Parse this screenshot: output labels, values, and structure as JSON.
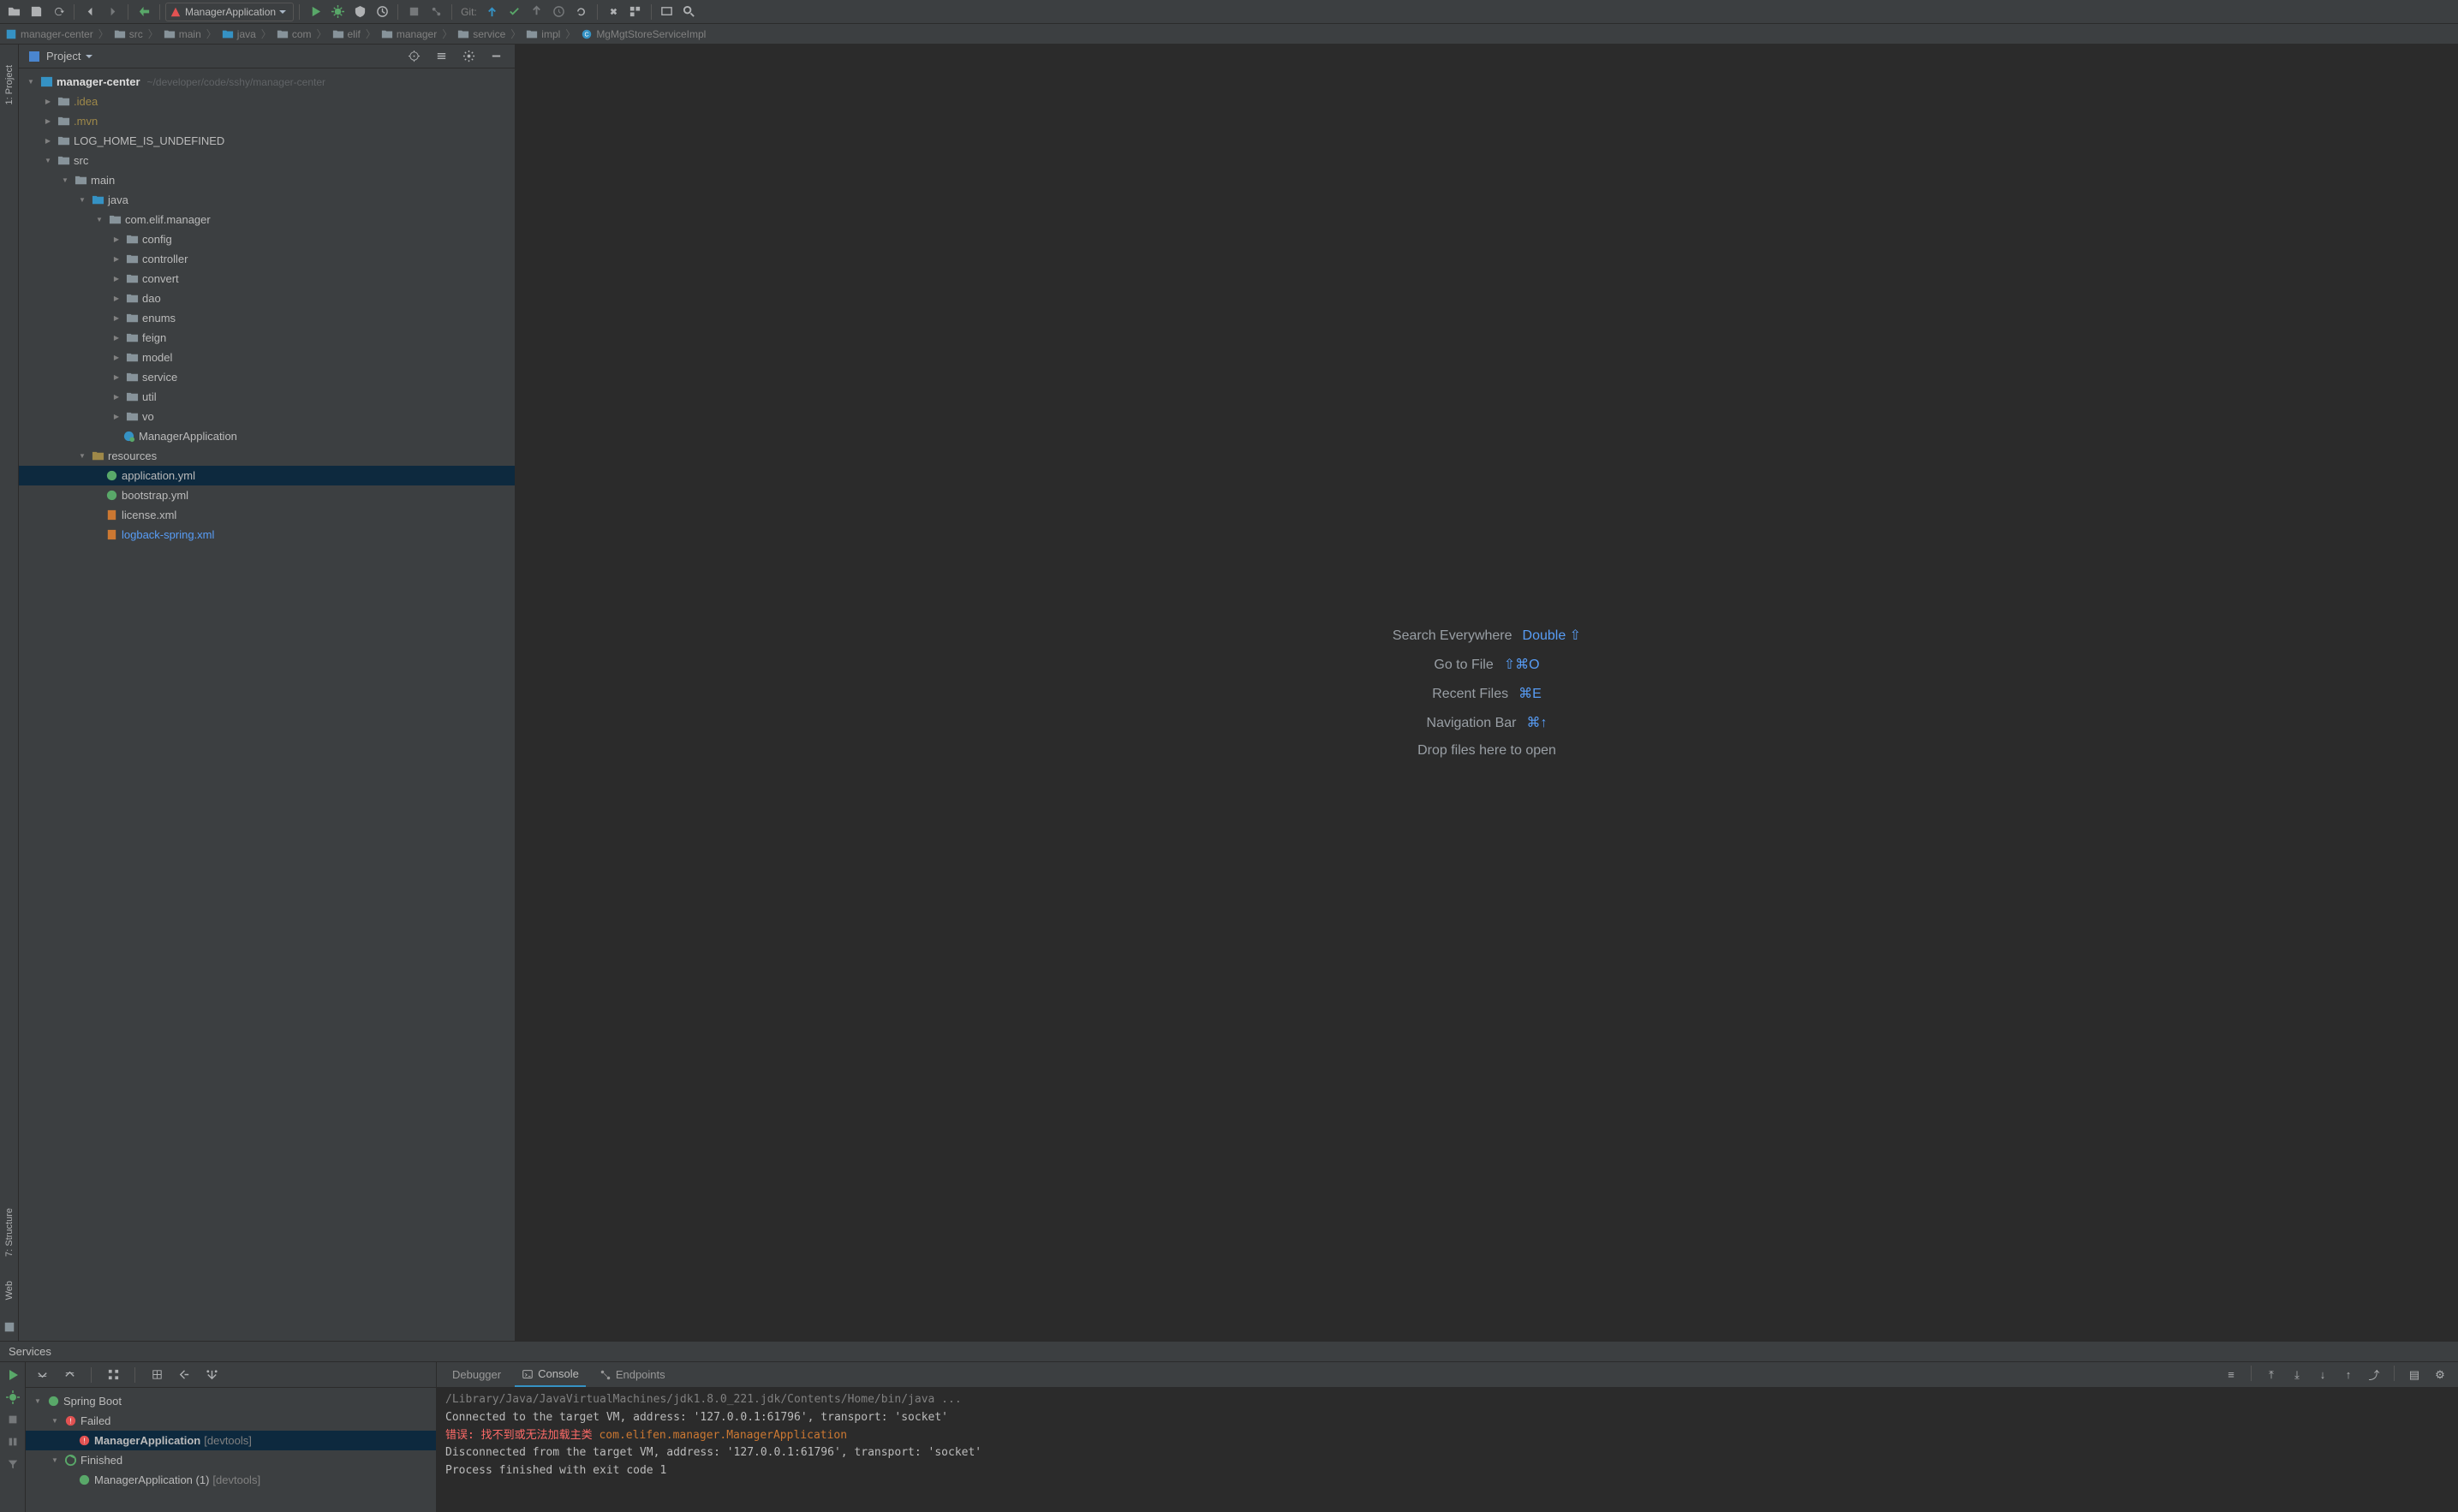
{
  "toolbar": {
    "run_config": "ManagerApplication",
    "git_label": "Git:"
  },
  "breadcrumbs": [
    {
      "icon": "module",
      "label": "manager-center"
    },
    {
      "icon": "folder",
      "label": "src"
    },
    {
      "icon": "folder",
      "label": "main"
    },
    {
      "icon": "folder",
      "label": "java"
    },
    {
      "icon": "folder",
      "label": "com"
    },
    {
      "icon": "folder",
      "label": "elif"
    },
    {
      "icon": "folder",
      "label": "manager"
    },
    {
      "icon": "folder",
      "label": "service"
    },
    {
      "icon": "folder",
      "label": "impl"
    },
    {
      "icon": "class",
      "label": "MgMgtStoreServiceImpl"
    }
  ],
  "gutter": {
    "project": "1: Project",
    "structure": "7: Structure",
    "web": "Web"
  },
  "project_panel": {
    "title": "Project",
    "root": {
      "label": "manager-center",
      "hint": "~/developer/code/sshy/manager-center"
    },
    "idea": ".idea",
    "mvn": ".mvn",
    "log_home": "LOG_HOME_IS_UNDEFINED",
    "src": "src",
    "main": "main",
    "java": "java",
    "pkg": "com.elif.manager",
    "config": "config",
    "controller": "controller",
    "convert": "convert",
    "dao": "dao",
    "enums": "enums",
    "feign": "feign",
    "model": "model",
    "service": "service",
    "util": "util",
    "vo": "vo",
    "manager_app": "ManagerApplication",
    "resources": "resources",
    "application_yml": "application.yml",
    "bootstrap_yml": "bootstrap.yml",
    "license_xml": "license.xml",
    "logback_xml": "logback-spring.xml"
  },
  "editor_hints": {
    "search": "Search Everywhere",
    "search_key": "Double ⇧",
    "goto": "Go to File",
    "goto_key": "⇧⌘O",
    "recent": "Recent Files",
    "recent_key": "⌘E",
    "nav": "Navigation Bar",
    "nav_key": "⌘↑",
    "drop": "Drop files here to open"
  },
  "services": {
    "title": "Services",
    "spring_boot": "Spring Boot",
    "failed": "Failed",
    "app": "ManagerApplication",
    "app_hint": "[devtools]",
    "finished": "Finished",
    "app2": "ManagerApplication (1)",
    "app2_hint": "[devtools]",
    "tabs": {
      "debugger": "Debugger",
      "console": "Console",
      "endpoints": "Endpoints"
    },
    "console": {
      "l1": "/Library/Java/JavaVirtualMachines/jdk1.8.0_221.jdk/Contents/Home/bin/java ...",
      "l2": "Connected to the target VM, address: '127.0.0.1:61796', transport: 'socket'",
      "l3_err": "错误: 找不到或无法加载主类 ",
      "l3_cls": "com.elifen.manager.ManagerApplication",
      "l4": "Disconnected from the target VM, address: '127.0.0.1:61796', transport: 'socket'",
      "l5": "",
      "l6": "Process finished with exit code 1"
    }
  }
}
